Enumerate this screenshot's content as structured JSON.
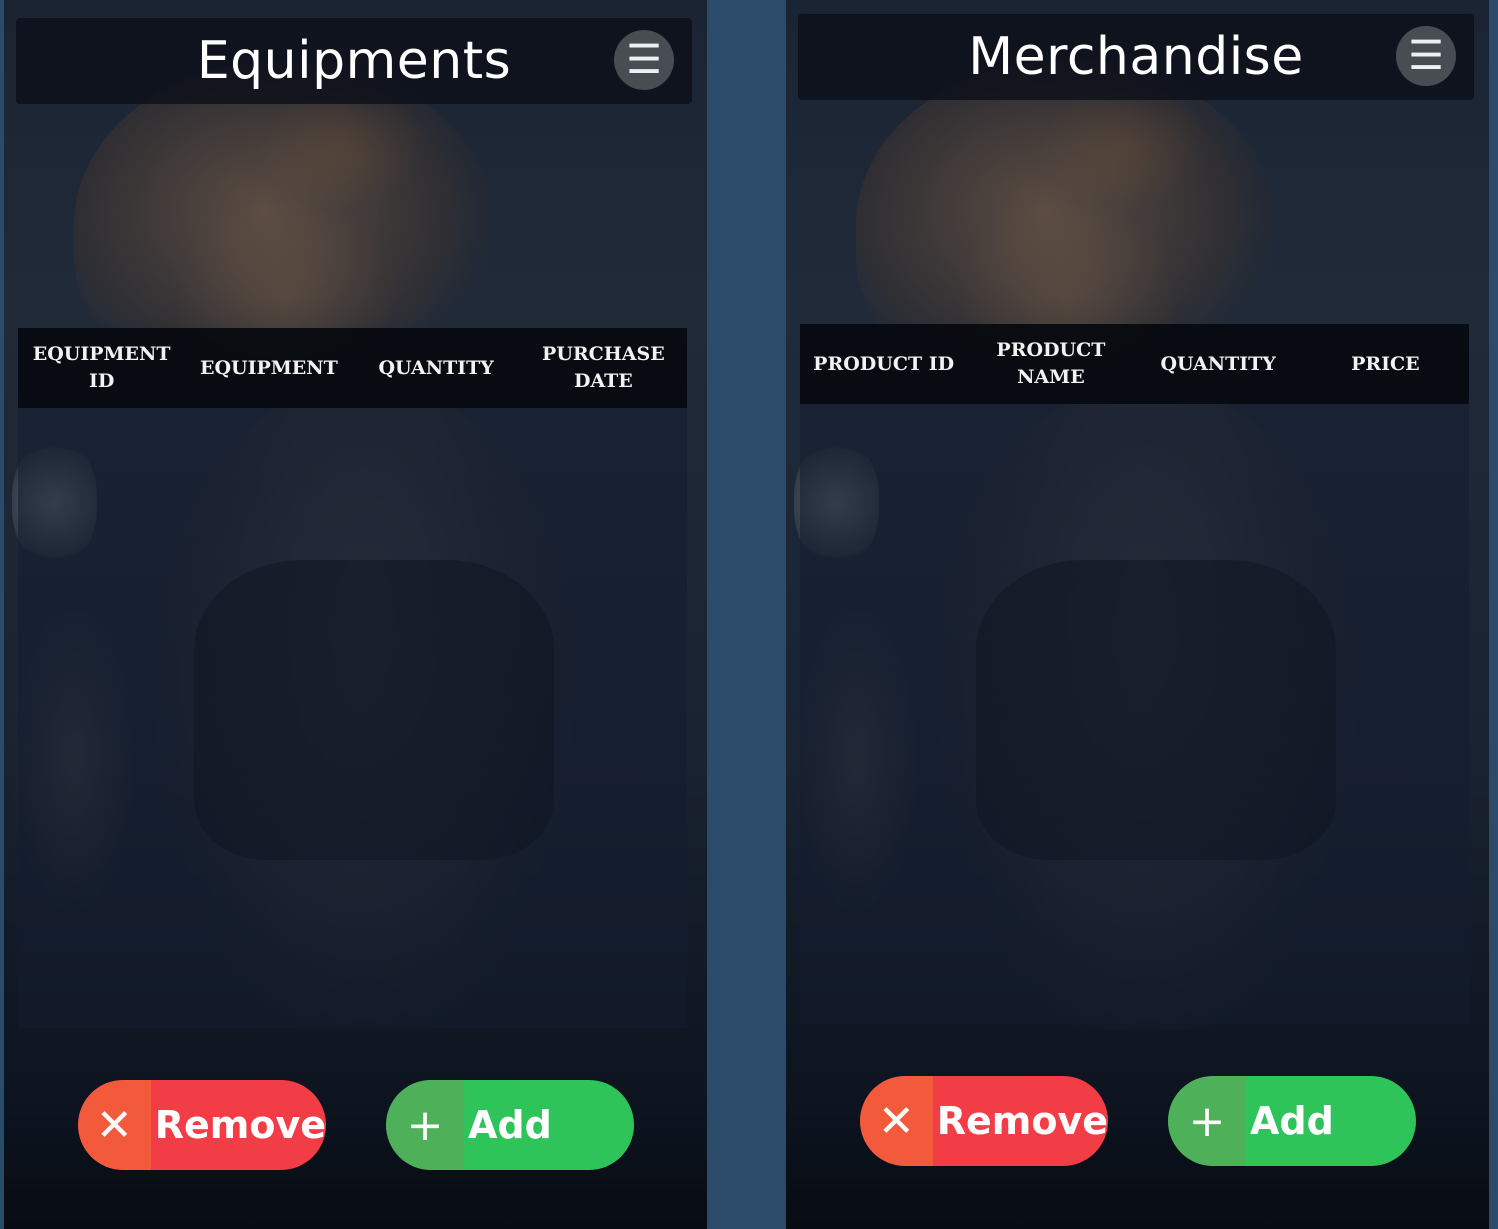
{
  "screens": [
    {
      "header": {
        "title": "Equipments",
        "menu_icon": "☰"
      },
      "table": {
        "columns": [
          "EQUIPMENT ID",
          "EQUIPMENT",
          "QUANTITY",
          "PURCHASE DATE"
        ],
        "rows": []
      },
      "actions": {
        "remove": {
          "label": "Remove",
          "icon": "✕",
          "color": "#f23d47"
        },
        "add": {
          "label": "Add",
          "icon": "+",
          "color": "#2fc45a"
        }
      }
    },
    {
      "header": {
        "title": "Merchandise",
        "menu_icon": "☰"
      },
      "table": {
        "columns": [
          "PRODUCT ID",
          "PRODUCT NAME",
          "QUANTITY",
          "PRICE"
        ],
        "rows": []
      },
      "actions": {
        "remove": {
          "label": "Remove",
          "icon": "✕",
          "color": "#f23d47"
        },
        "add": {
          "label": "Add",
          "icon": "+",
          "color": "#2fc45a"
        }
      }
    }
  ],
  "colors": {
    "page_background": "#2c4a69",
    "header_background": "#0a0e18",
    "table_header_background": "#06080c"
  }
}
